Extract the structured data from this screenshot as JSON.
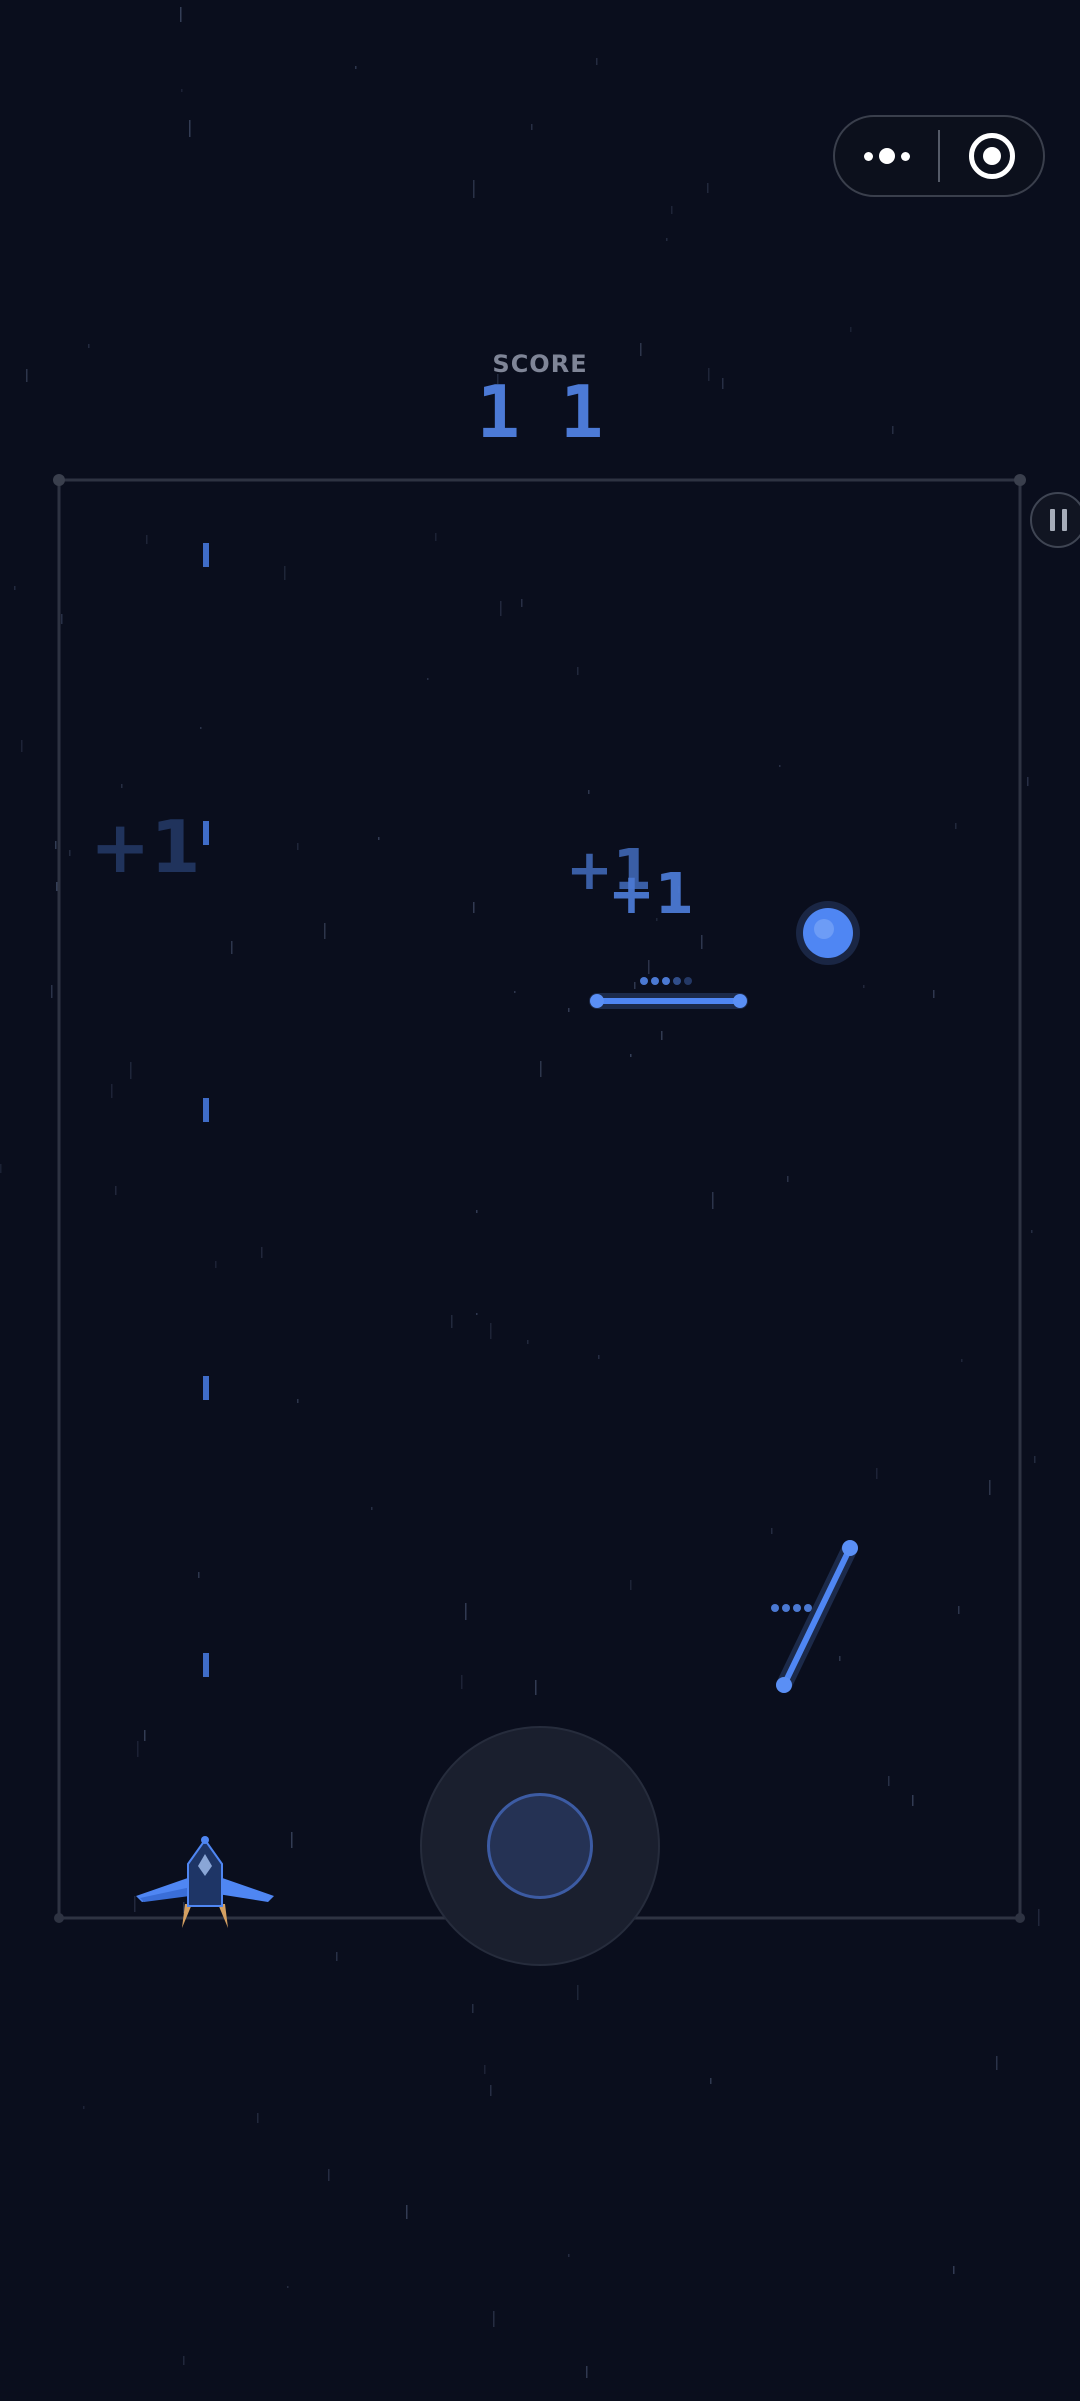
{
  "app": {
    "capsule": {
      "more_icon": "more-dots-icon",
      "close_icon": "target-ring-icon"
    },
    "pause_icon": "pause-icon"
  },
  "hud": {
    "score_label": "SCORE",
    "score_value": "11"
  },
  "floating_texts": [
    "+1",
    "+1",
    "+1"
  ],
  "colors": {
    "background": "#0a0e1d",
    "accent": "#4b79d3",
    "ball": "#4f86f3",
    "arena_border": "#2c3140"
  },
  "entities": {
    "player": "blue-jet-fighter",
    "ball": "glowing-blue-orb",
    "paddles": [
      "horizontal-laser-paddle",
      "diagonal-laser-paddle"
    ],
    "joystick": "virtual-joystick"
  }
}
